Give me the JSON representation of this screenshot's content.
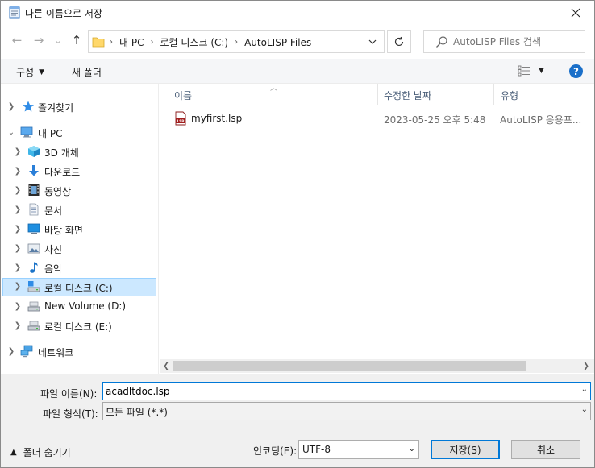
{
  "window": {
    "title": "다른 이름으로 저장",
    "close_glyph": "✕"
  },
  "nav_buttons": {
    "back": "←",
    "forward": "→",
    "recent": "⌄",
    "up": "↑"
  },
  "address": {
    "crumbs": [
      "내 PC",
      "로컬 디스크 (C:)",
      "AutoLISP Files"
    ],
    "separator": "›"
  },
  "search": {
    "placeholder": "AutoLISP Files 검색"
  },
  "toolbar": {
    "organize_label": "구성",
    "new_folder_label": "새 폴더",
    "help_glyph": "?"
  },
  "sidebar": {
    "items": [
      {
        "label": "즐겨찾기",
        "icon": "star-icon",
        "expanded": false
      },
      {
        "label": "내 PC",
        "icon": "computer-icon",
        "expanded": true
      },
      {
        "label": "3D 개체",
        "icon": "3d-objects-icon",
        "expanded": false
      },
      {
        "label": "다운로드",
        "icon": "download-icon",
        "expanded": false
      },
      {
        "label": "동영상",
        "icon": "video-icon",
        "expanded": false
      },
      {
        "label": "문서",
        "icon": "document-icon",
        "expanded": false
      },
      {
        "label": "바탕 화면",
        "icon": "desktop-icon",
        "expanded": false
      },
      {
        "label": "사진",
        "icon": "pictures-icon",
        "expanded": false
      },
      {
        "label": "음악",
        "icon": "music-icon",
        "expanded": false
      },
      {
        "label": "로컬 디스크 (C:)",
        "icon": "drive-windows-icon",
        "expanded": false,
        "selected": true
      },
      {
        "label": "New Volume (D:)",
        "icon": "drive-icon",
        "expanded": false
      },
      {
        "label": "로컬 디스크 (E:)",
        "icon": "drive-icon",
        "expanded": false
      },
      {
        "label": "네트워크",
        "icon": "network-icon",
        "expanded": false
      }
    ]
  },
  "filelist": {
    "columns": [
      "이름",
      "수정한 날짜",
      "유형"
    ],
    "files": [
      {
        "name": "myfirst.lsp",
        "modified": "2023-05-25 오후 5:48",
        "type": "AutoLISP 응용프..."
      }
    ]
  },
  "form": {
    "filename_label": "파일 이름(N):",
    "filename_value": "acadltdoc.lsp",
    "filetype_label": "파일 형식(T):",
    "filetype_value": "모든 파일 (*.*)",
    "hide_folders_label": "폴더 숨기기",
    "encoding_label": "인코딩(E):",
    "encoding_value": "UTF-8",
    "save_label": "저장(S)",
    "cancel_label": "취소"
  },
  "colors": {
    "selection_bg": "#cce8ff",
    "selection_border": "#99d1ff",
    "accent": "#0078d7",
    "help_blue": "#1a6fc9"
  }
}
